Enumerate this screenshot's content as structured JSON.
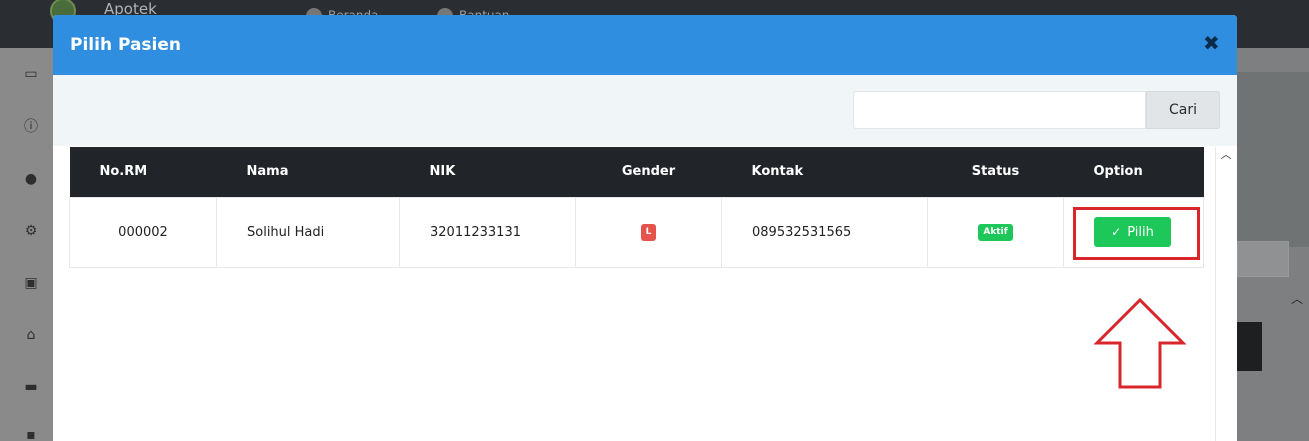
{
  "background": {
    "brand": "Apotek",
    "nav": [
      {
        "label": "Beranda",
        "icon": "home-icon"
      },
      {
        "label": "Bantuan",
        "icon": "help-icon"
      }
    ],
    "sidebar_icons": [
      "monitor-icon",
      "info-icon",
      "user-icon",
      "gear-icon",
      "contact-card-icon",
      "house-icon",
      "bed-icon",
      "briefcase-icon"
    ]
  },
  "modal": {
    "title": "Pilih Pasien",
    "close_icon": "close-icon",
    "search": {
      "value": "",
      "placeholder": "",
      "button_label": "Cari"
    },
    "table": {
      "headers": [
        "No.RM",
        "Nama",
        "NIK",
        "Gender",
        "Kontak",
        "Status",
        "Option"
      ],
      "rows": [
        {
          "no_rm": "000002",
          "nama": "Solihul Hadi",
          "nik": "32011233131",
          "gender": "L",
          "kontak": "089532531565",
          "status": "Aktif",
          "option_label": "Pilih"
        }
      ]
    }
  },
  "colors": {
    "header": "#2f8ee0",
    "table_head": "#212529",
    "gender_badge": "#e5534b",
    "status_badge": "#1ec75a",
    "pilih_button": "#1ec75a",
    "highlight": "#d8262b"
  }
}
